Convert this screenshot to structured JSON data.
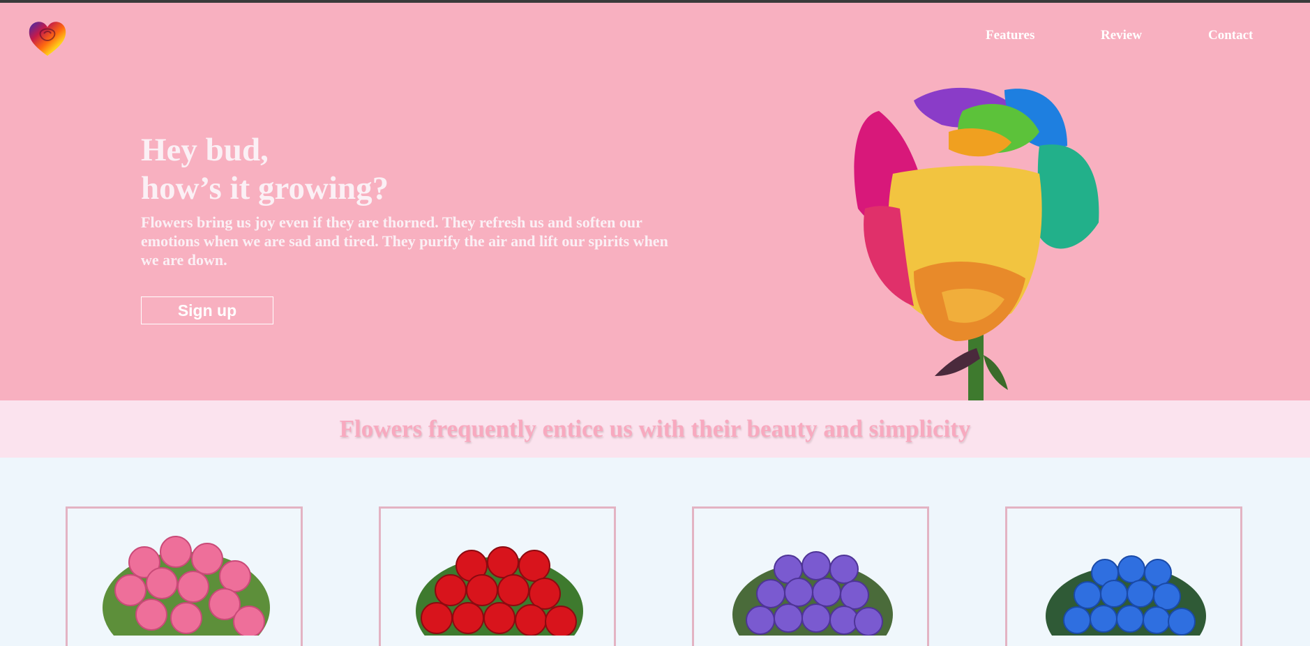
{
  "nav": {
    "items": [
      {
        "label": "Features"
      },
      {
        "label": "Review"
      },
      {
        "label": "Contact"
      }
    ]
  },
  "logo": {
    "icon": "rainbow-heart-rose-logo-icon"
  },
  "hero": {
    "title_line1": "Hey bud,",
    "title_line2": "how’s it growing?",
    "text": "Flowers bring us joy even if they are thorned. They refresh us and soften our emotions when we are sad and tired. They purify the air and lift our spirits when we are down.",
    "signup_label": "Sign up",
    "image_icon": "rainbow-rose-icon"
  },
  "tagline": "Flowers frequently entice us with their beauty and simplicity",
  "products": [
    {
      "icon": "pink-rose-bouquet-icon",
      "color": "#ee6f9a"
    },
    {
      "icon": "red-rose-bouquet-icon",
      "color": "#d8141c"
    },
    {
      "icon": "purple-rose-bouquet-icon",
      "color": "#7a5ad0"
    },
    {
      "icon": "blue-rose-bouquet-icon",
      "color": "#2f6fe0"
    }
  ],
  "colors": {
    "hero_bg": "#f8b0c0",
    "tagline_bg": "#fbe3ee",
    "tagline_text": "#f8a9bf",
    "page_bg": "#eef6fc",
    "card_border": "#e3b3c3"
  }
}
